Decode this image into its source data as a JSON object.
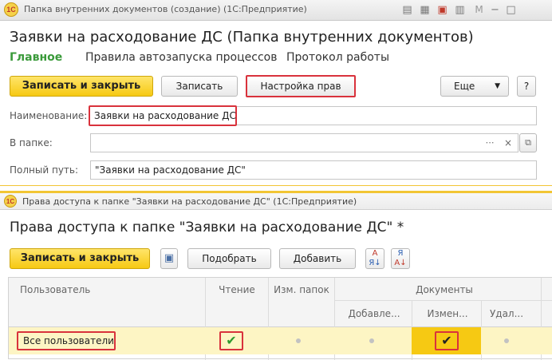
{
  "window1": {
    "title": "Папка внутренних документов (создание) (1С:Предприятие)",
    "logo": "1С",
    "toolbar_icons": [
      "sheet-icon",
      "table-icon",
      "calendar-icon",
      "calculator-icon",
      "memory-icon",
      "minimize-icon",
      "restore-icon"
    ],
    "memory_label": "M",
    "heading": "Заявки на расходование ДС (Папка внутренних документов)",
    "tabs": [
      "Главное",
      "Правила автозапуска процессов",
      "Протокол работы"
    ],
    "buttons": {
      "save_close": "Записать и закрыть",
      "save": "Записать",
      "permissions": "Настройка прав",
      "more": "Еще",
      "help": "?"
    },
    "fields": {
      "name_label": "Наименование:",
      "name_value": "Заявки на расходование ДС",
      "folder_label": "В папке:",
      "folder_value": "",
      "path_label": "Полный путь:",
      "path_value": "\"Заявки на расходование ДС\""
    }
  },
  "window2": {
    "title": "Права доступа к папке \"Заявки на расходование ДС\" (1С:Предприятие)",
    "heading": "Права доступа к папке \"Заявки на расходование ДС\" *",
    "buttons": {
      "save_close": "Записать и закрыть",
      "pick": "Подобрать",
      "add": "Добавить"
    },
    "table": {
      "headers": {
        "user": "Пользователь",
        "read": "Чтение",
        "change_folders": "Изм. папок",
        "documents": "Документы",
        "add": "Добавле...",
        "edit": "Измен...",
        "delete": "Удал..."
      },
      "rows": [
        {
          "user": "Все пользователи",
          "read": true,
          "change_folders": false,
          "add": false,
          "edit": true,
          "delete": false
        }
      ]
    }
  },
  "colors": {
    "accent_yellow": "#f6c913",
    "highlight_red": "#d9323c",
    "active_tab_green": "#3a9a3a",
    "row_highlight": "#fdf5c4",
    "selected_cell": "#f6c913"
  }
}
